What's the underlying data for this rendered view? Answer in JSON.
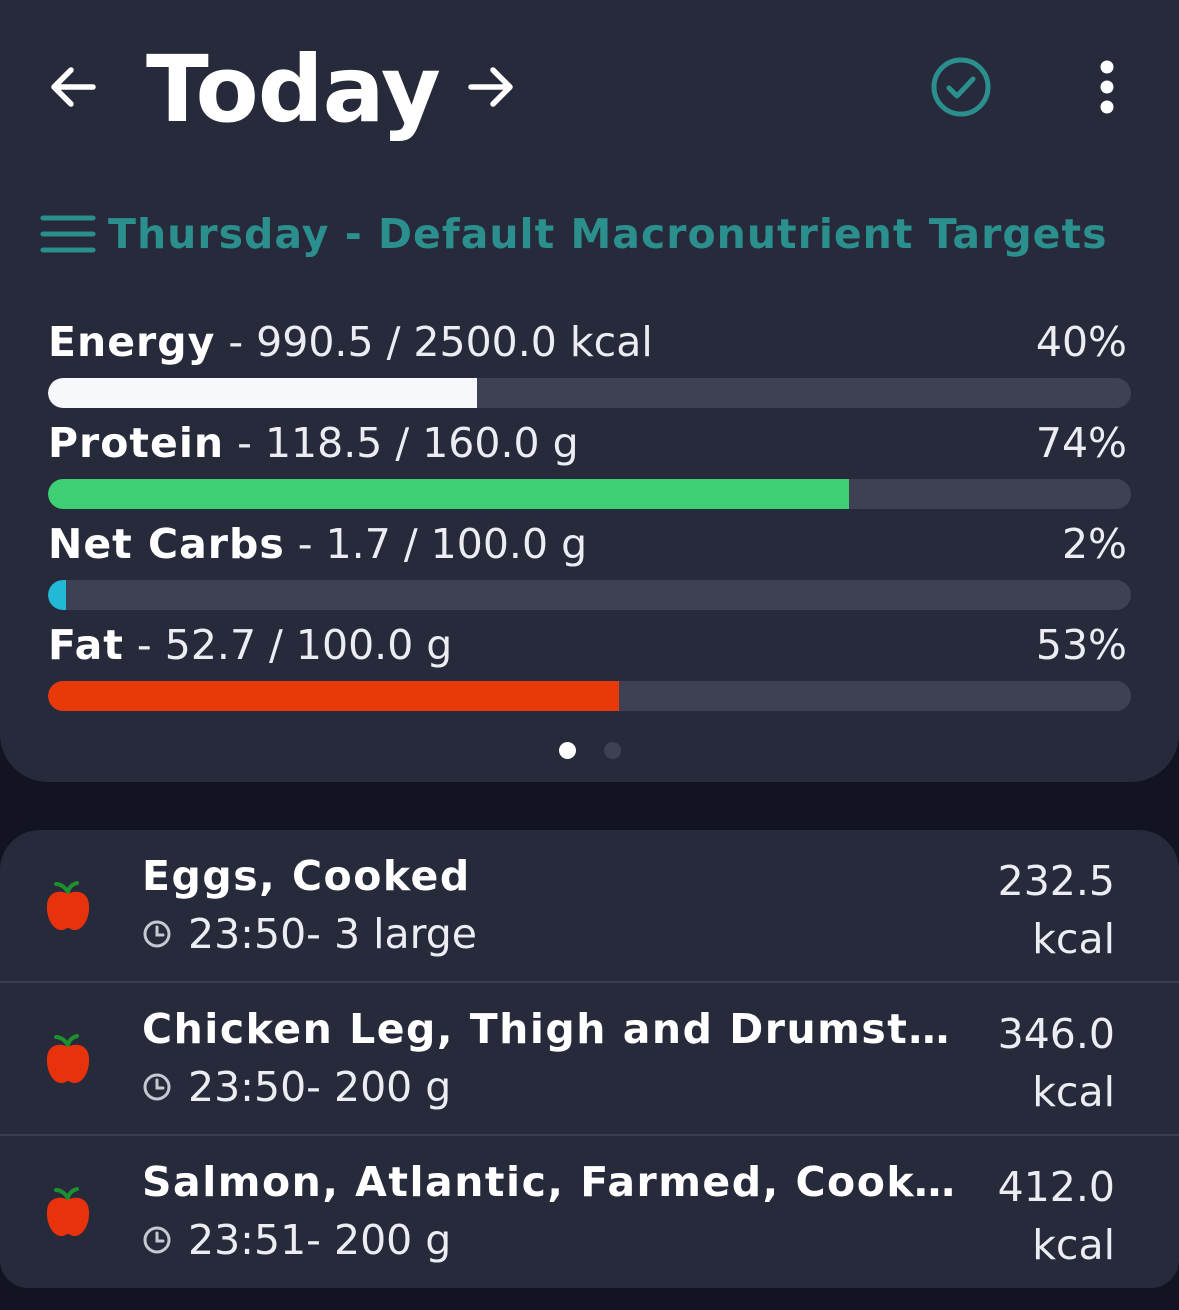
{
  "header": {
    "title": "Today",
    "icons": {
      "back": "arrow-left-icon",
      "forward": "arrow-right-icon",
      "check": "check-circle-icon",
      "more": "more-vertical-icon"
    }
  },
  "targets": {
    "label": "Thursday - Default Macronutrient Targets",
    "icon": "menu-lines-icon",
    "color": "#2b8f8e"
  },
  "macros": [
    {
      "name": "Energy",
      "detail": " - 990.5 / 2500.0 kcal",
      "percent": "40%",
      "fraction": 0.396,
      "color": "#f7f8fb"
    },
    {
      "name": "Protein",
      "detail": " - 118.5 / 160.0 g",
      "percent": "74%",
      "fraction": 0.74,
      "color": "#3fcf75"
    },
    {
      "name": "Net Carbs",
      "detail": " - 1.7 / 100.0 g",
      "percent": "2%",
      "fraction": 0.017,
      "color": "#22b9d6"
    },
    {
      "name": "Fat",
      "detail": " - 52.7 / 100.0 g",
      "percent": "53%",
      "fraction": 0.527,
      "color": "#e83a08"
    }
  ],
  "pager": {
    "pages": 2,
    "active": 0
  },
  "entries": [
    {
      "food": "Eggs, Cooked",
      "time": "23:50",
      "amount": " - 3 large",
      "kcal": "232.5",
      "unit": "kcal",
      "icon": "apple-icon"
    },
    {
      "food": "Chicken Leg, Thigh and Drumstick, S…",
      "time": "23:50",
      "amount": " - 200 g",
      "kcal": "346.0",
      "unit": "kcal",
      "icon": "apple-icon"
    },
    {
      "food": "Salmon, Atlantic, Farmed, Cooked",
      "time": "23:51",
      "amount": " - 200 g",
      "kcal": "412.0",
      "unit": "kcal",
      "icon": "apple-icon"
    }
  ]
}
